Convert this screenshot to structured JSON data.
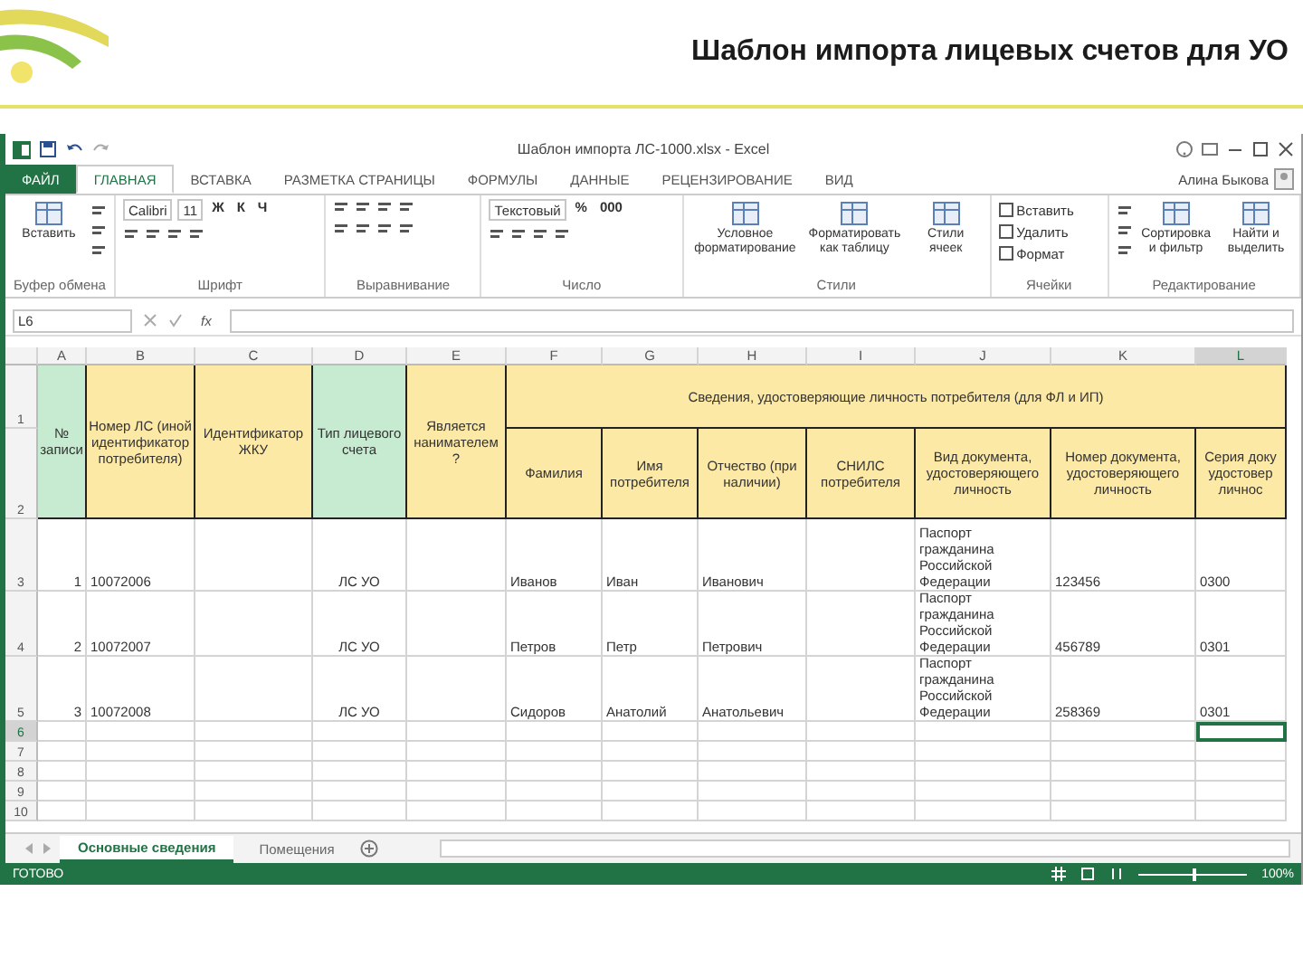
{
  "slide": {
    "title": "Шаблон импорта лицевых счетов для УО"
  },
  "window": {
    "title": "Шаблон импорта ЛС-1000.xlsx - Excel",
    "account": "Алина Быкова"
  },
  "ribbon_tabs": [
    {
      "label": "ФАЙЛ",
      "kind": "file",
      "selected": false
    },
    {
      "label": "ГЛАВНАЯ",
      "kind": "tab",
      "selected": true
    },
    {
      "label": "ВСТАВКА",
      "kind": "tab",
      "selected": false
    },
    {
      "label": "РАЗМЕТКА СТРАНИЦЫ",
      "kind": "tab",
      "selected": false
    },
    {
      "label": "ФОРМУЛЫ",
      "kind": "tab",
      "selected": false
    },
    {
      "label": "ДАННЫЕ",
      "kind": "tab",
      "selected": false
    },
    {
      "label": "РЕЦЕНЗИРОВАНИЕ",
      "kind": "tab",
      "selected": false
    },
    {
      "label": "ВИД",
      "kind": "tab",
      "selected": false
    }
  ],
  "ribbon_groups": [
    {
      "label": "Буфер обмена",
      "items": [
        {
          "kind": "big",
          "text": "Вставить"
        },
        {
          "kind": "icons"
        }
      ]
    },
    {
      "label": "Шрифт",
      "items": [
        {
          "kind": "field",
          "text": "Calibri"
        },
        {
          "kind": "field",
          "text": "11"
        },
        {
          "kind": "glyph",
          "text": "Ж"
        },
        {
          "kind": "glyph",
          "text": "К"
        },
        {
          "kind": "glyph",
          "text": "Ч"
        },
        {
          "kind": "icons"
        }
      ]
    },
    {
      "label": "Выравнивание",
      "items": [
        {
          "kind": "icons"
        },
        {
          "kind": "icons"
        }
      ]
    },
    {
      "label": "Число",
      "items": [
        {
          "kind": "field",
          "text": "Текстовый"
        },
        {
          "kind": "glyph",
          "text": "%"
        },
        {
          "kind": "glyph",
          "text": "000"
        },
        {
          "kind": "icons"
        }
      ]
    },
    {
      "label": "Стили",
      "items": [
        {
          "kind": "big",
          "text": "Условное форматирование"
        },
        {
          "kind": "big",
          "text": "Форматировать как таблицу"
        },
        {
          "kind": "big",
          "text": "Стили ячеек"
        }
      ]
    },
    {
      "label": "Ячейки",
      "items": [
        {
          "kind": "small",
          "text": "Вставить"
        },
        {
          "kind": "small",
          "text": "Удалить"
        },
        {
          "kind": "small",
          "text": "Формат"
        }
      ]
    },
    {
      "label": "Редактирование",
      "items": [
        {
          "kind": "icons"
        },
        {
          "kind": "big",
          "text": "Сортировка и фильтр"
        },
        {
          "kind": "big",
          "text": "Найти и выделить"
        }
      ]
    }
  ],
  "formula_bar": {
    "name_box": "L6",
    "function_label": "fx"
  },
  "sheet": {
    "columns": [
      "A",
      "B",
      "C",
      "D",
      "E",
      "F",
      "G",
      "H",
      "I",
      "J",
      "K",
      "L"
    ],
    "header_row_numbers": [
      "1",
      "2"
    ],
    "main_headers": [
      {
        "text": "№ записи",
        "color": "#c6ebd0"
      },
      {
        "text": "Номер ЛС (иной идентификатор потребителя)",
        "color": "#fde9a6"
      },
      {
        "text": "Идентификатор ЖКУ",
        "color": "#fde9a6"
      },
      {
        "text": "Тип лицевого счета",
        "color": "#c6ebd0"
      },
      {
        "text": "Является нанимателем ?",
        "color": "#fde9a6"
      }
    ],
    "group_header": {
      "text": "Сведения, удостоверяющие личность потребителя (для ФЛ и ИП)",
      "color": "#fde9a6"
    },
    "sub_headers": [
      "Фамилия",
      "Имя потребителя",
      "Отчество (при наличии)",
      "СНИЛС потребителя",
      "Вид документа, удостоверяющего личность",
      "Номер документа, удостоверяющего личность",
      "Серия доку удостовер личнос"
    ],
    "rows": [
      {
        "number": "3",
        "selected": false,
        "cells": [
          "1",
          "10072006",
          null,
          "ЛС УО",
          null,
          "Иванов",
          "Иван",
          "Иванович",
          null,
          "Паспорт гражданина Российской Федерации",
          "123456",
          "0300"
        ]
      },
      {
        "number": "4",
        "selected": false,
        "cells": [
          "2",
          "10072007",
          null,
          "ЛС УО",
          null,
          "Петров",
          "Петр",
          "Петрович",
          null,
          "Паспорт гражданина Российской Федерации",
          "456789",
          "0301"
        ]
      },
      {
        "number": "5",
        "selected": false,
        "cells": [
          "3",
          "10072008",
          null,
          "ЛС УО",
          null,
          "Сидоров",
          "Анатолий",
          "Анатольевич",
          null,
          "Паспорт гражданина Российской Федерации",
          "258369",
          "0301"
        ]
      },
      {
        "number": "6",
        "selected": true,
        "cells": []
      },
      {
        "number": "7",
        "selected": false,
        "cells": []
      },
      {
        "number": "8",
        "selected": false,
        "cells": []
      },
      {
        "number": "9",
        "selected": false,
        "cells": []
      },
      {
        "number": "10",
        "selected": false,
        "cells": []
      }
    ]
  },
  "sheet_tabs": [
    {
      "label": "Основные сведения",
      "selected": true
    },
    {
      "label": "Помещения",
      "selected": false
    }
  ],
  "status_bar": {
    "status": "ГОТОВО",
    "zoom": "100%",
    "zoom_slider": {
      "level": 0.5
    }
  }
}
